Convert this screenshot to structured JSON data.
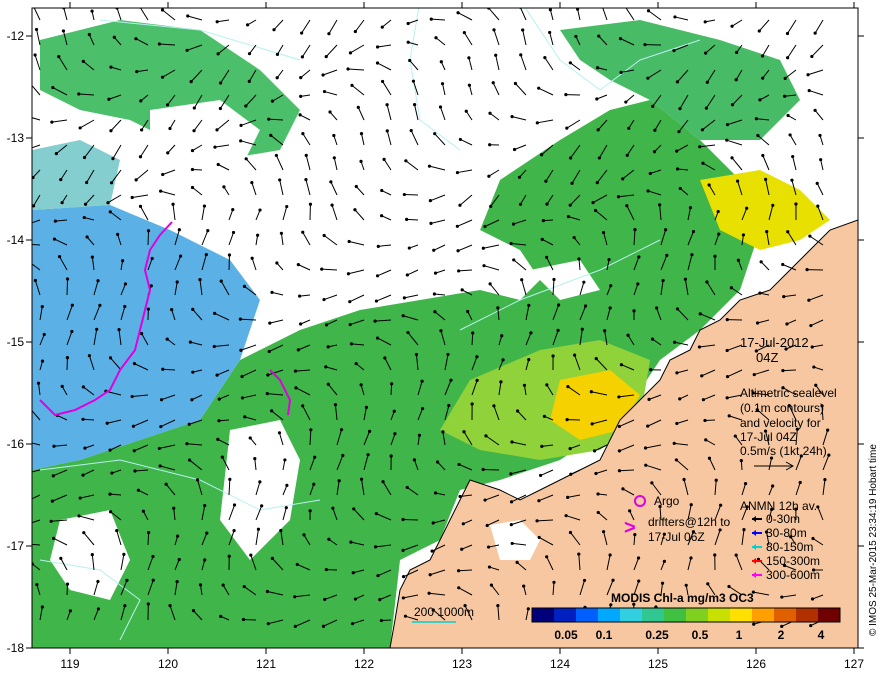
{
  "axes": {
    "lon_ticks": [
      "119",
      "120",
      "121",
      "122",
      "123",
      "124",
      "125",
      "126",
      "127"
    ],
    "lat_ticks": [
      "-12",
      "-13",
      "-14",
      "-15",
      "-16",
      "-17",
      "-18"
    ]
  },
  "date": {
    "day": "17-Jul-2012",
    "hour": "04Z"
  },
  "altimetry": {
    "line1": "Altimetric sealevel",
    "line2": "(0.1m contours)",
    "line3": "and velocity for",
    "line4": "17-Jul 04Z",
    "line5": "0.5m/s (1kt 24h)"
  },
  "argo": {
    "label": "Argo",
    "color": "#e000e0"
  },
  "drifters": {
    "symbol": ">",
    "line1": "drifters@12h to",
    "line2": "17-Jul 06Z",
    "color": "#e000e0"
  },
  "anmn": {
    "title": "ANMN 12h av.",
    "items": [
      {
        "label": "0-30m",
        "color": "#000000"
      },
      {
        "label": "30-80m",
        "color": "#0000ff"
      },
      {
        "label": "80-150m",
        "color": "#00d0d0"
      },
      {
        "label": "150-300m",
        "color": "#ff0000"
      },
      {
        "label": "300-600m",
        "color": "#ff00ff"
      }
    ]
  },
  "colorbar": {
    "title": "MODIS Chl-a mg/m3 OC3",
    "tick_labels": [
      "0.05",
      "0.1",
      "0.25",
      "0.5",
      "1",
      "2",
      "4"
    ],
    "colors": [
      "#00007a",
      "#0020c0",
      "#0060ff",
      "#00a8ff",
      "#30d0e0",
      "#30c890",
      "#40c040",
      "#80d020",
      "#c8e000",
      "#ffe000",
      "#ffa000",
      "#e06000",
      "#b03000",
      "#700000"
    ]
  },
  "scale": {
    "label": "200  1000m",
    "color": "#00d0d0"
  },
  "credit": "© IMOS 25-Mar-2015 23:34:19 Hobart time",
  "colors": {
    "land": "#f6c7a0",
    "cloud": "#ffffff",
    "chl_low": "#6ab7e6",
    "chl_mid": "#39b54a",
    "chl_high": "#ffc000"
  }
}
